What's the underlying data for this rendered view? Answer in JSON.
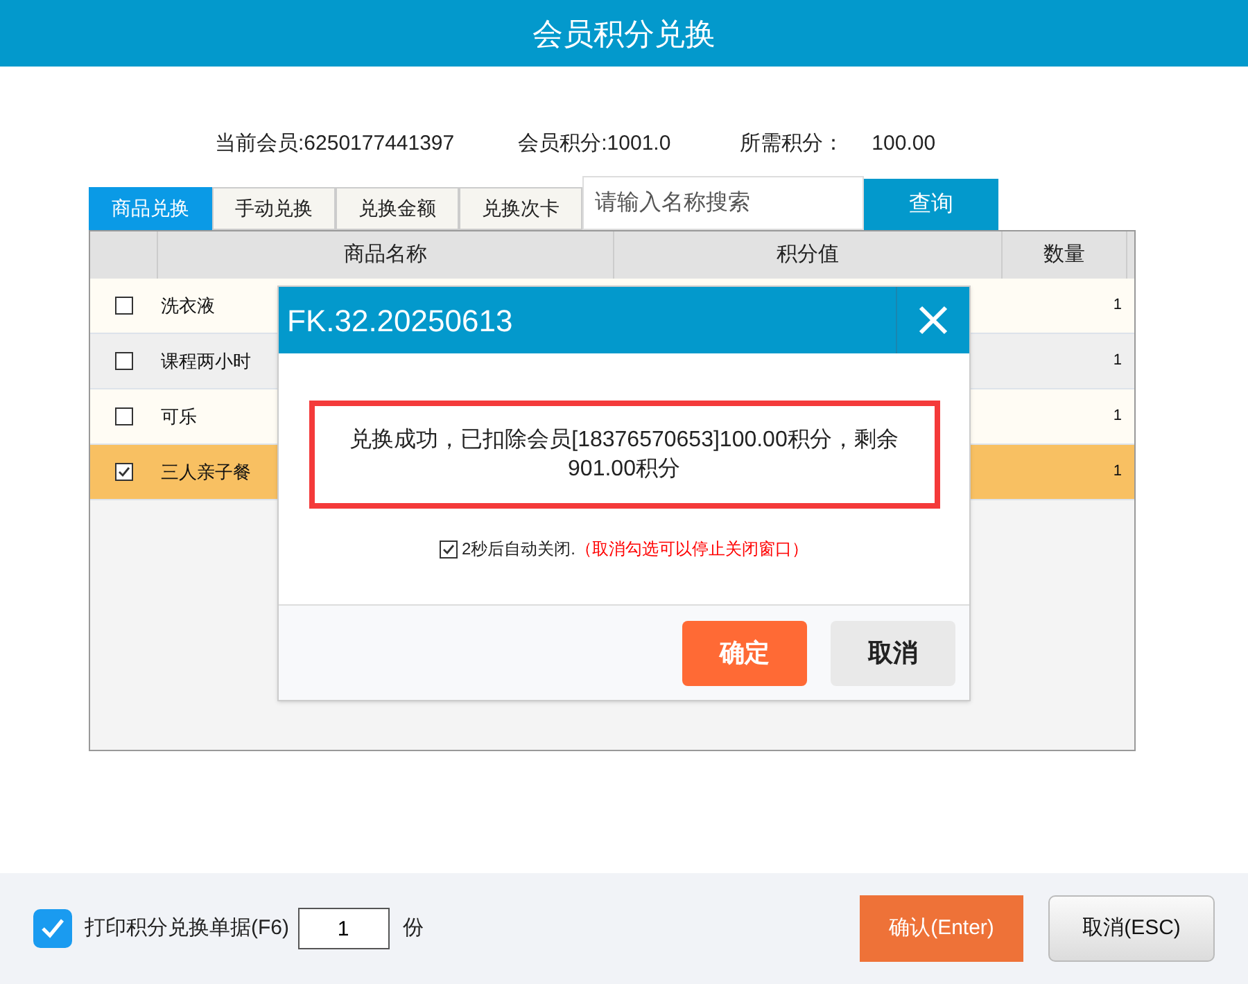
{
  "window": {
    "title": "会员积分兑换"
  },
  "member_info": [
    {
      "label": "当前会员:6250177441397"
    },
    {
      "label": "会员积分:1001.0"
    },
    {
      "label": "所需积分：",
      "value": "100.00"
    }
  ],
  "tabs": [
    {
      "label": "商品兑换",
      "selected": true
    },
    {
      "label": "手动兑换",
      "selected": false
    },
    {
      "label": "兑换金额",
      "selected": false
    },
    {
      "label": "兑换次卡",
      "selected": false
    }
  ],
  "search": {
    "placeholder": "请输入名称搜索",
    "button": "查询"
  },
  "table": {
    "columns": [
      "商品名称",
      "积分值",
      "数量"
    ],
    "rows": [
      {
        "name": "洗衣液",
        "quantity": "1",
        "checked": false,
        "selected": false
      },
      {
        "name": "课程两小时",
        "quantity": "1",
        "checked": false,
        "selected": false
      },
      {
        "name": "可乐",
        "quantity": "1",
        "checked": false,
        "selected": false
      },
      {
        "name": "三人亲子餐",
        "quantity": "1",
        "checked": true,
        "selected": true
      }
    ]
  },
  "dialog": {
    "title": "FK.32.20250613",
    "message": "兑换成功，已扣除会员[18376570653]100.00积分，剩余901.00积分",
    "auto_close": {
      "checked": true,
      "label": "2秒后自动关闭.",
      "hint": "（取消勾选可以停止关闭窗口）"
    },
    "buttons": [
      "确定",
      "取消"
    ]
  },
  "footer": {
    "print": {
      "checked": true,
      "label": "打印积分兑换单据(F6)",
      "copies": "1",
      "unit": "份"
    },
    "buttons": [
      "确认(Enter)",
      "取消(ESC)"
    ]
  }
}
